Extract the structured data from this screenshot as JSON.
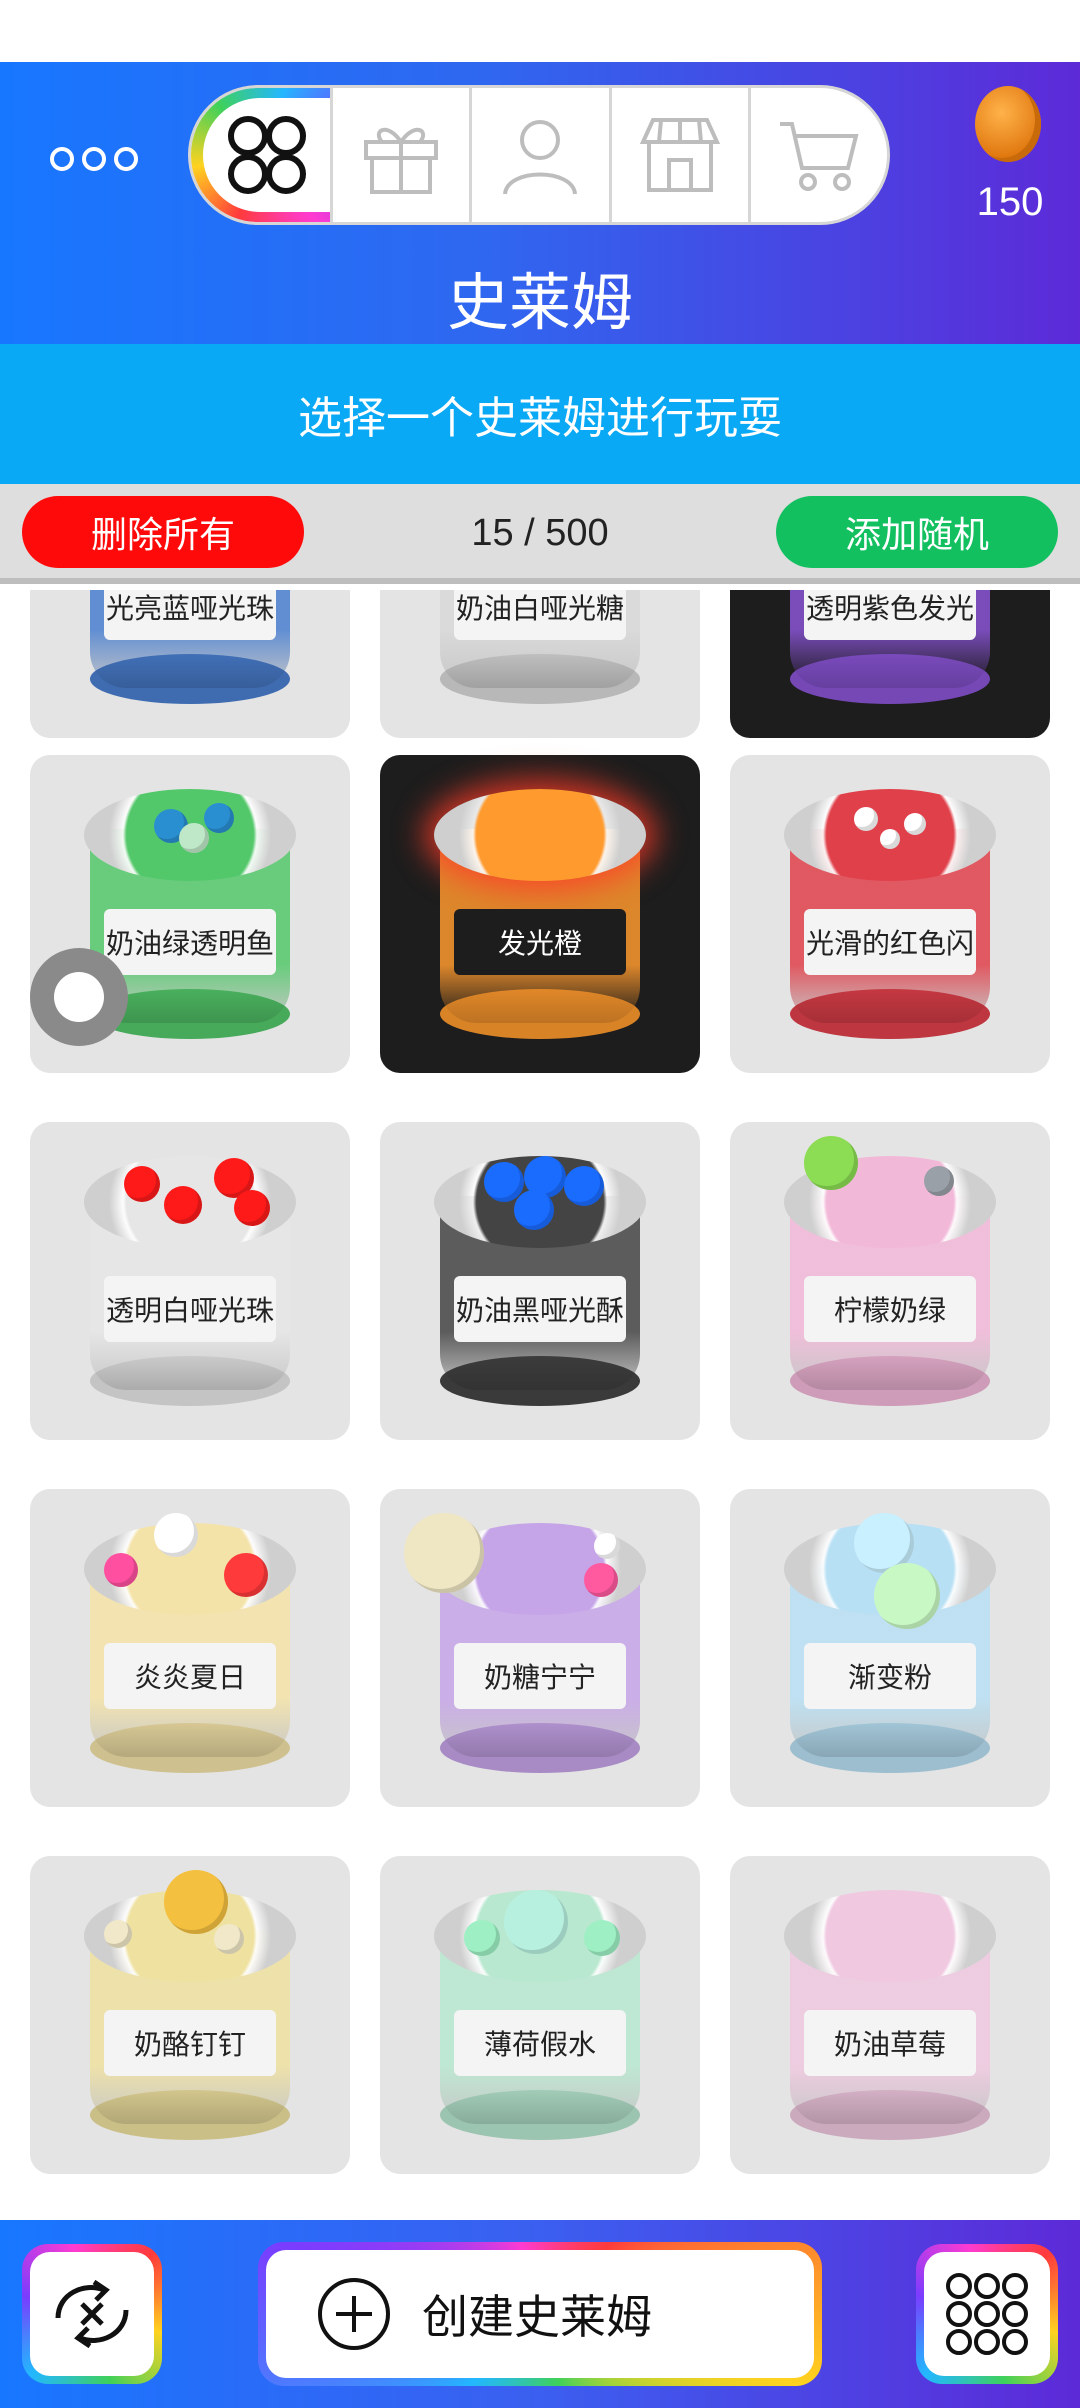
{
  "header": {
    "title": "史莱姆",
    "coins": "150",
    "tabs": [
      "slimes-grid-icon",
      "gift-icon",
      "profile-icon",
      "shop-icon",
      "cart-icon"
    ]
  },
  "subtitle": "选择一个史莱姆进行玩耍",
  "actions": {
    "delete_all": "删除所有",
    "counter": "15 / 500",
    "add_random": "添加随机"
  },
  "slimes": [
    {
      "name": "光亮蓝哑光珠",
      "color": "#4a7fd0"
    },
    {
      "name": "奶油白哑光糖",
      "color": "#d8d8d8"
    },
    {
      "name": "透明紫色发光",
      "color": "#8a55d6"
    },
    {
      "name": "奶油绿透明鱼",
      "color": "#53c86a"
    },
    {
      "name": "发光橙",
      "color": "#ff9a2e"
    },
    {
      "name": "光滑的红色闪",
      "color": "#e0404a"
    },
    {
      "name": "透明白哑光珠",
      "color": "#e6e6e6"
    },
    {
      "name": "奶油黑哑光酥",
      "color": "#444444"
    },
    {
      "name": "柠檬奶绿",
      "color": "#f2b8d8"
    },
    {
      "name": "炎炎夏日",
      "color": "#f4e3a8"
    },
    {
      "name": "奶糖宁宁",
      "color": "#c6a4e8"
    },
    {
      "name": "渐变粉",
      "color": "#b8e0f4"
    },
    {
      "name": "奶酪钉钉",
      "color": "#efe1a0"
    },
    {
      "name": "薄荷假水",
      "color": "#b8e8d0"
    },
    {
      "name": "奶油草莓",
      "color": "#f0c8e0"
    }
  ],
  "bottom": {
    "create_label": "创建史莱姆"
  }
}
